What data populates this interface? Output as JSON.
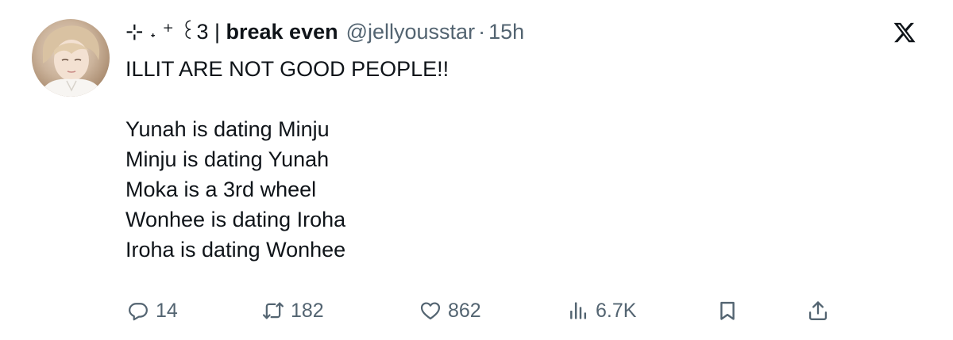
{
  "tweet": {
    "display_name_prefix": "⊹ ˖ ⁺ ꒰3 | ",
    "display_name": "break even",
    "handle": "@jellyousstar",
    "separator": "·",
    "time": "15h",
    "lines": [
      "ILLIT ARE NOT GOOD PEOPLE!!",
      "",
      "Yunah is dating Minju",
      "Minju is dating Yunah",
      "Moka is a 3rd wheel",
      "Wonhee is dating Iroha",
      "Iroha is dating Wonhee"
    ]
  },
  "actions": {
    "replies": "14",
    "reposts": "182",
    "likes": "862",
    "views": "6.7K"
  },
  "icons": {
    "logo": "x-logo-icon",
    "reply": "reply-icon",
    "repost": "repost-icon",
    "like": "heart-icon",
    "views": "views-icon",
    "bookmark": "bookmark-icon",
    "share": "share-icon"
  },
  "colors": {
    "text_primary": "#0f1419",
    "text_secondary": "#536471"
  }
}
